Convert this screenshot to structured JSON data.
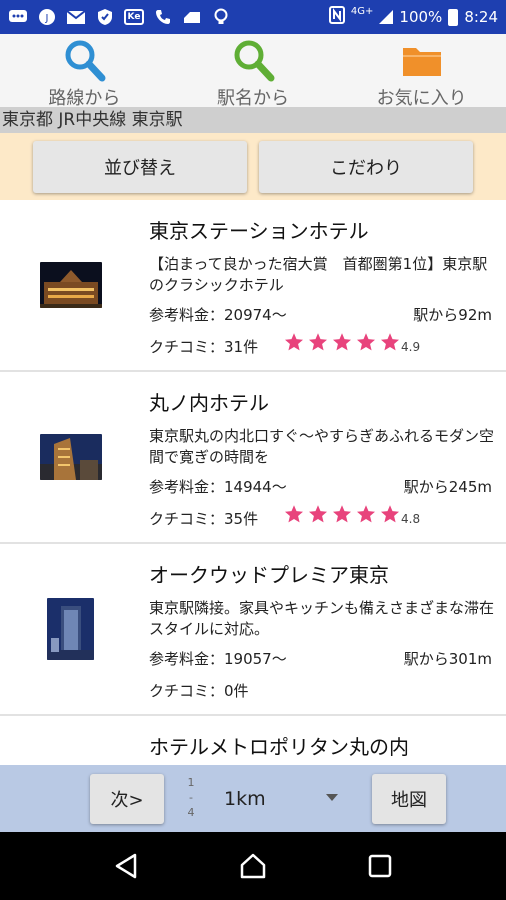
{
  "status_bar": {
    "network": "4G+",
    "battery": "100%",
    "time": "8:24"
  },
  "top_nav": [
    {
      "label": "路線から",
      "icon": "search-icon",
      "color": "#2f8fd3"
    },
    {
      "label": "駅名から",
      "icon": "search-icon",
      "color": "#5fae35"
    },
    {
      "label": "お気に入り",
      "icon": "folder-icon",
      "color": "#f0902a"
    }
  ],
  "breadcrumb": "東京都  JR中央線  東京駅",
  "filters": {
    "sort_label": "並び替え",
    "preferences_label": "こだわり"
  },
  "hotels": [
    {
      "name": "東京ステーションホテル",
      "description": "【泊まって良かった宿大賞　首都圏第1位】東京駅のクラシックホテル",
      "price": "参考料金：20974〜",
      "distance": "駅から92m",
      "reviews": "クチコミ：31件",
      "rating": 4.9,
      "rating_text": "4.9",
      "stars": 5
    },
    {
      "name": "丸ノ内ホテル",
      "description": "東京駅丸の内北口すぐ〜やすらぎあふれるモダン空間で寛ぎの時間を",
      "price": "参考料金：14944〜",
      "distance": "駅から245m",
      "reviews": "クチコミ：35件",
      "rating": 4.8,
      "rating_text": "4.8",
      "stars": 5
    },
    {
      "name": "オークウッドプレミア東京",
      "description": "東京駅隣接。家具やキッチンも備えさまざまな滞在スタイルに対応。",
      "price": "参考料金：19057〜",
      "distance": "駅から301m",
      "reviews": "クチコミ：0件",
      "rating": null,
      "rating_text": "",
      "stars": 0
    },
    {
      "name": "ホテルメトロポリタン丸の内"
    }
  ],
  "bottom_bar": {
    "next_label": "次>",
    "page_current": "1",
    "page_sep": "-",
    "page_total": "4",
    "radius_value": "1km",
    "map_label": "地図"
  },
  "colors": {
    "status_bar": "#1e3fb0",
    "star": "#e8437c",
    "filter_bar": "#fde9c8",
    "bottom_bar": "#b9c9e4"
  }
}
